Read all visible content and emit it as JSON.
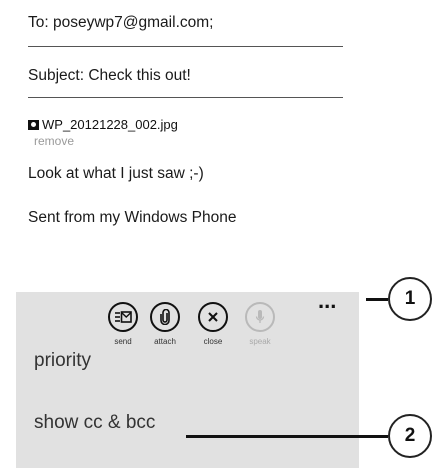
{
  "compose": {
    "to_label": "To:",
    "to_value": "poseywp7@gmail.com;",
    "subject_label": "Subject:",
    "subject_value": "Check this out!",
    "attachment_name": "WP_20121228_002.jpg",
    "attachment_remove": "remove",
    "body_line1": "Look at what I just saw ;-)",
    "body_line2": "Sent from my Windows Phone"
  },
  "appbar": {
    "buttons": [
      {
        "label": "send",
        "icon": "send-mail-icon",
        "enabled": true
      },
      {
        "label": "attach",
        "icon": "paperclip-icon",
        "enabled": true
      },
      {
        "label": "close",
        "icon": "close-icon",
        "enabled": true
      },
      {
        "label": "speak",
        "icon": "microphone-icon",
        "enabled": false
      }
    ],
    "more": "...",
    "menu": [
      "priority",
      "show cc & bcc"
    ]
  },
  "callouts": [
    "1",
    "2"
  ]
}
